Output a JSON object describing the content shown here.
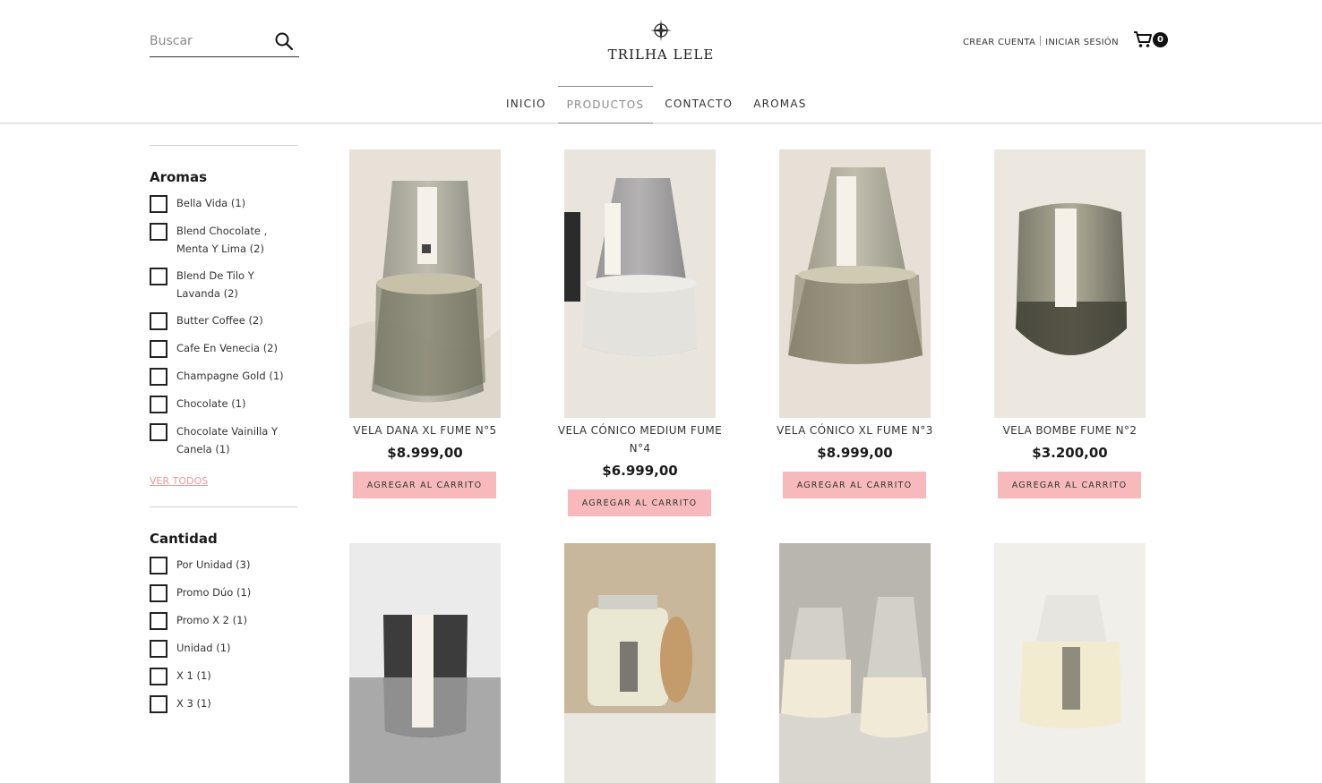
{
  "header": {
    "search_placeholder": "Buscar",
    "logo_text": "TRILHA LELE",
    "create_account": "CREAR CUENTA",
    "login": "INICIAR SESIÓN",
    "cart_count": "0"
  },
  "nav": {
    "items": [
      {
        "label": "INICIO"
      },
      {
        "label": "PRODUCTOS"
      },
      {
        "label": "CONTACTO"
      },
      {
        "label": "AROMAS"
      }
    ],
    "active": "PRODUCTOS"
  },
  "filters": {
    "aromas": {
      "title": "Aromas",
      "items": [
        {
          "label": "Bella Vida (1)"
        },
        {
          "label": "Blend Chocolate , Menta Y Lima (2)"
        },
        {
          "label": "Blend De Tilo Y Lavanda (2)"
        },
        {
          "label": "Butter Coffee (2)"
        },
        {
          "label": "Cafe En Venecia (2)"
        },
        {
          "label": "Champagne Gold (1)"
        },
        {
          "label": "Chocolate (1)"
        },
        {
          "label": "Chocolate Vainilla Y Canela (1)"
        }
      ],
      "view_all": "VER TODOS"
    },
    "cantidad": {
      "title": "Cantidad",
      "items": [
        {
          "label": "Por Unidad (3)"
        },
        {
          "label": "Promo Dúo (1)"
        },
        {
          "label": "Promo X 2 (1)"
        },
        {
          "label": "Unidad (1)"
        },
        {
          "label": "X 1 (1)"
        },
        {
          "label": "X 3 (1)"
        }
      ]
    }
  },
  "products": [
    {
      "name": "VELA DANA XL FUME N°5",
      "price": "$8.999,00",
      "button": "AGREGAR AL CARRITO"
    },
    {
      "name": "VELA CÓNICO MEDIUM FUME N°4",
      "price": "$6.999,00",
      "button": "AGREGAR AL CARRITO"
    },
    {
      "name": "VELA CÓNICO XL FUME N°3",
      "price": "$8.999,00",
      "button": "AGREGAR AL CARRITO"
    },
    {
      "name": "VELA BOMBE FUME N°2",
      "price": "$3.200,00",
      "button": "AGREGAR AL CARRITO"
    }
  ],
  "colors": {
    "accent_button": "#f7b9bb",
    "link_pink": "#e8989c",
    "text_dark": "#1a1a1a"
  },
  "icons": [
    "search-icon",
    "logo-compass-icon",
    "cart-icon"
  ]
}
